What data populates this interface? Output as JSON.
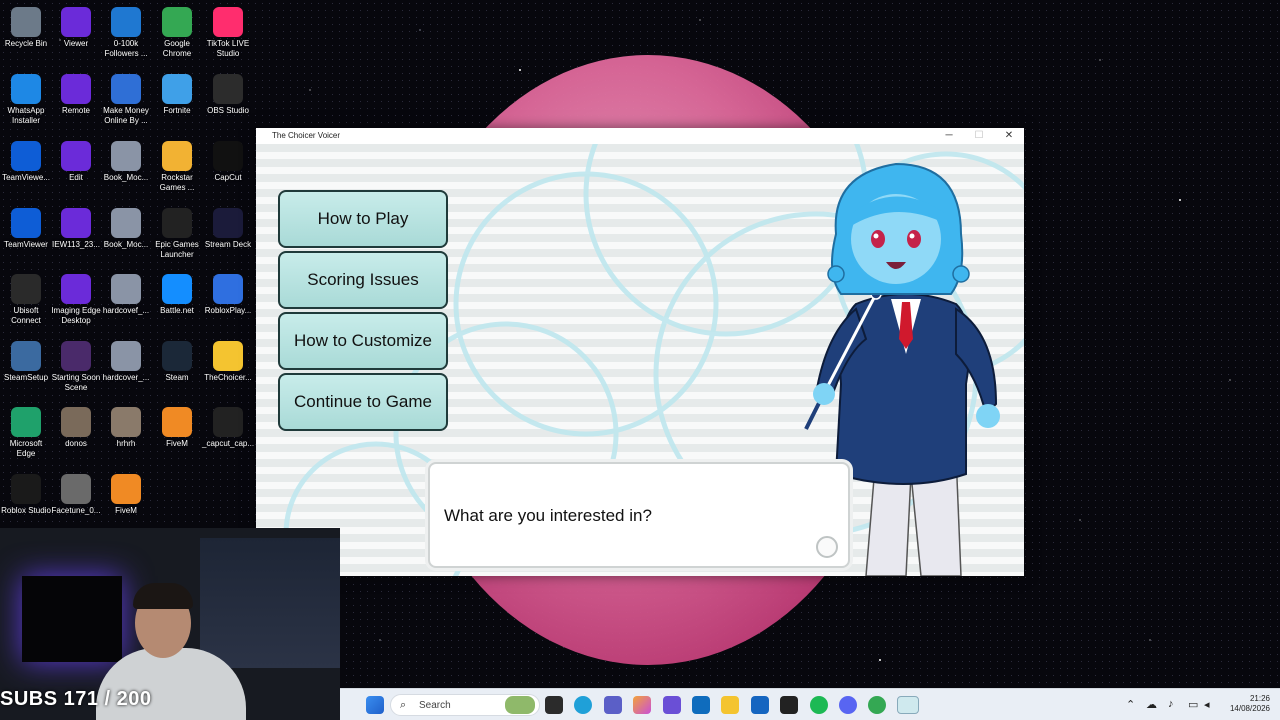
{
  "desktop": {
    "icons": [
      {
        "label": "Recycle Bin",
        "icon": "recycle-bin-icon",
        "color": "#6c7a89"
      },
      {
        "label": "Viewer",
        "icon": "iedt-icon",
        "color": "#6b2bd9"
      },
      {
        "label": "0-100k Followers ...",
        "icon": "document-icon",
        "color": "#1f78d1"
      },
      {
        "label": "Google Chrome",
        "icon": "chrome-icon",
        "color": "#34a853"
      },
      {
        "label": "TikTok LIVE Studio",
        "icon": "tiktok-icon",
        "color": "#ff2d6e"
      },
      {
        "label": "WhatsApp Installer",
        "icon": "download-icon",
        "color": "#1e88e5"
      },
      {
        "label": "Remote",
        "icon": "iedt-icon",
        "color": "#6b2bd9"
      },
      {
        "label": "Make Money Online By ...",
        "icon": "document-icon",
        "color": "#2f6fd6"
      },
      {
        "label": "Fortnite",
        "icon": "fortnite-icon",
        "color": "#3fa0e8"
      },
      {
        "label": "OBS Studio",
        "icon": "obs-icon",
        "color": "#2c2c2c"
      },
      {
        "label": "TeamViewe...",
        "icon": "teamviewer-icon",
        "color": "#0e5dd6"
      },
      {
        "label": "Edit",
        "icon": "iedt-icon",
        "color": "#6b2bd9"
      },
      {
        "label": "Book_Moc...",
        "icon": "image-file-icon",
        "color": "#8a94a6"
      },
      {
        "label": "Rockstar Games ...",
        "icon": "rockstar-icon",
        "color": "#f2b233"
      },
      {
        "label": "CapCut",
        "icon": "capcut-icon",
        "color": "#111111"
      },
      {
        "label": "TeamViewer",
        "icon": "teamviewer-icon",
        "color": "#0e5dd6"
      },
      {
        "label": "IEW113_23...",
        "icon": "iew-icon",
        "color": "#6b2bd9"
      },
      {
        "label": "Book_Moc...",
        "icon": "image-file-icon",
        "color": "#8a94a6"
      },
      {
        "label": "Epic Games Launcher",
        "icon": "epic-games-icon",
        "color": "#222222"
      },
      {
        "label": "Stream Deck",
        "icon": "stream-deck-icon",
        "color": "#1b1b3a"
      },
      {
        "label": "Ubisoft Connect",
        "icon": "ubisoft-icon",
        "color": "#2a2a2a"
      },
      {
        "label": "Imaging Edge Desktop",
        "icon": "iedt-icon",
        "color": "#6b2bd9"
      },
      {
        "label": "hardcovef_...",
        "icon": "image-file-icon",
        "color": "#8a94a6"
      },
      {
        "label": "Battle.net",
        "icon": "battlenet-icon",
        "color": "#148eff"
      },
      {
        "label": "RobloxPlay...",
        "icon": "roblox-icon",
        "color": "#2f6fe0"
      },
      {
        "label": "SteamSetup",
        "icon": "steam-setup-icon",
        "color": "#3b6aa0"
      },
      {
        "label": "Starting Soon Scene",
        "icon": "video-file-icon",
        "color": "#4a2a6a"
      },
      {
        "label": "hardcover_...",
        "icon": "image-file-icon",
        "color": "#8a94a6"
      },
      {
        "label": "Steam",
        "icon": "steam-icon",
        "color": "#1b2838"
      },
      {
        "label": "TheChoicer...",
        "icon": "folder-icon",
        "color": "#f4c430"
      },
      {
        "label": "Microsoft Edge",
        "icon": "edge-icon",
        "color": "#1fa16b"
      },
      {
        "label": "donos",
        "icon": "photo-icon",
        "color": "#7a6a5a"
      },
      {
        "label": "hrhrh",
        "icon": "photo-icon",
        "color": "#8a7a6a"
      },
      {
        "label": "FiveM",
        "icon": "fivem-icon",
        "color": "#f08a24"
      },
      {
        "label": "_capcut_cap...",
        "icon": "capcut-file-icon",
        "color": "#222222"
      },
      {
        "label": "Roblox Studio",
        "icon": "roblox-studio-icon",
        "color": "#1a1a1a"
      },
      {
        "label": "Facetune_0...",
        "icon": "photo-icon",
        "color": "#6a6a6a"
      },
      {
        "label": "FiveM",
        "icon": "fivem-icon",
        "color": "#f08a24"
      }
    ]
  },
  "window": {
    "title": "The Choicer Voicer",
    "minimize": "─",
    "maximize": "☐",
    "close": "✕"
  },
  "game": {
    "menu": [
      {
        "label": "How to Play"
      },
      {
        "label": "Scoring Issues"
      },
      {
        "label": "How to Customize"
      },
      {
        "label": "Continue to Game"
      }
    ],
    "dialog_text": "What are you interested in?",
    "colors": {
      "button_fill": "#bfe6e3",
      "button_border": "#1f3a3a",
      "character_hair": "#3fb6ef",
      "character_suit": "#1f3f7a"
    }
  },
  "overlay": {
    "subs_text": "SUBS 171 / 200"
  },
  "taskbar": {
    "search_placeholder": "Search",
    "time": "21:26",
    "date": "14/08/2026"
  }
}
